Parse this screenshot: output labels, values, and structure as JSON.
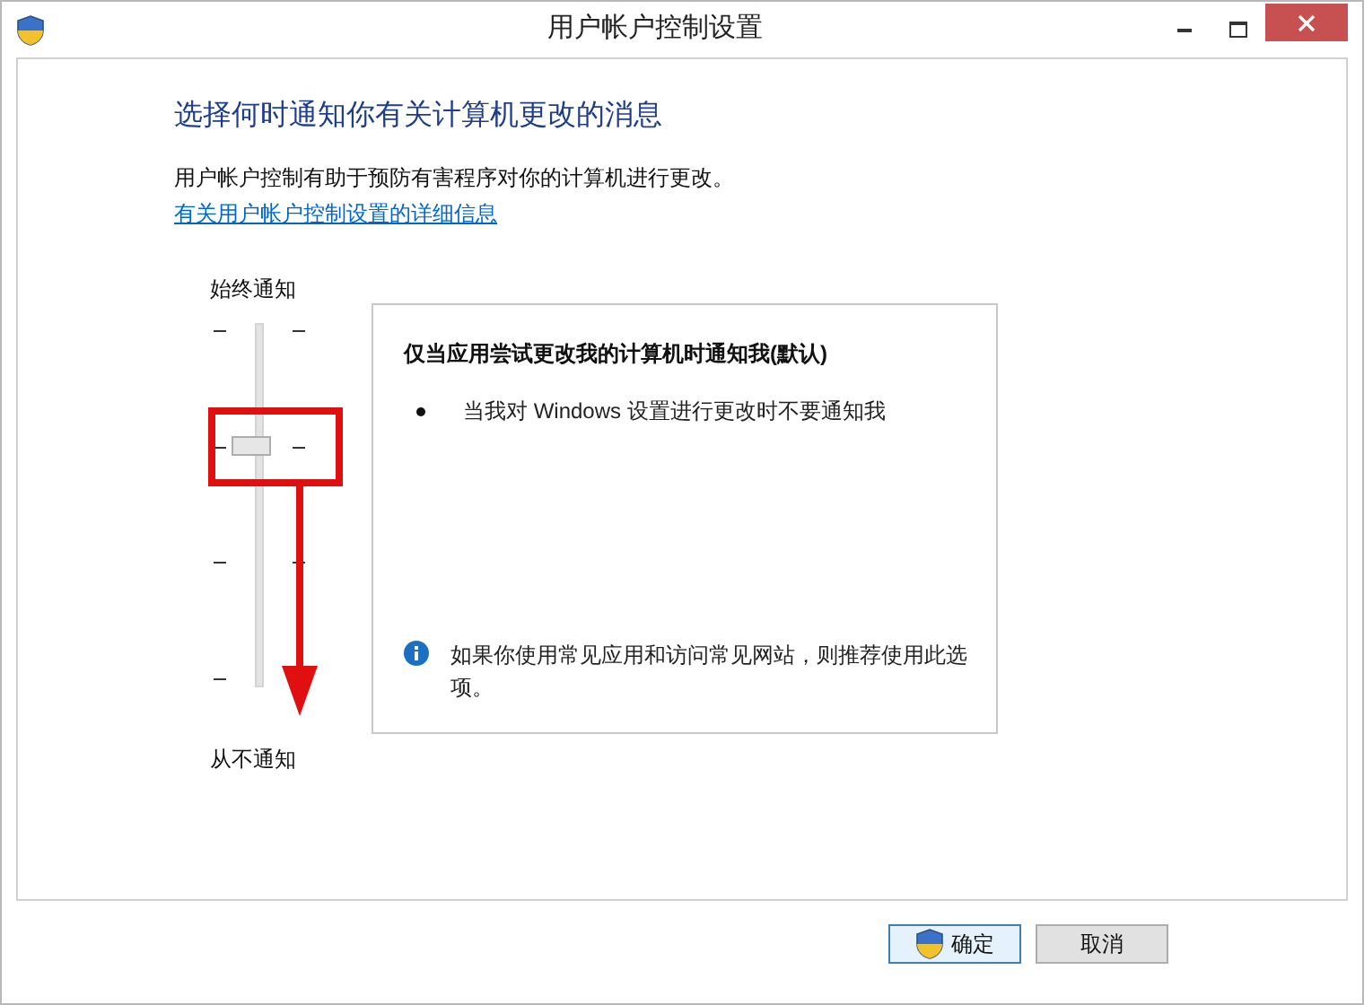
{
  "window": {
    "title": "用户帐户控制设置"
  },
  "heading": "选择何时通知你有关计算机更改的消息",
  "intro": "用户帐户控制有助于预防有害程序对你的计算机进行更改。",
  "link": "有关用户帐户控制设置的详细信息",
  "slider": {
    "top_label": "始终通知",
    "bottom_label": "从不通知",
    "level": 0.667
  },
  "description": {
    "title": "仅当应用尝试更改我的计算机时通知我(默认)",
    "bullets": [
      "当我对 Windows 设置进行更改时不要通知我"
    ],
    "note": "如果你使用常见应用和访问常见网站，则推荐使用此选项。"
  },
  "buttons": [
    {
      "label": "确定",
      "kind": "shield"
    },
    {
      "label": "取消",
      "kind": "plain"
    }
  ]
}
